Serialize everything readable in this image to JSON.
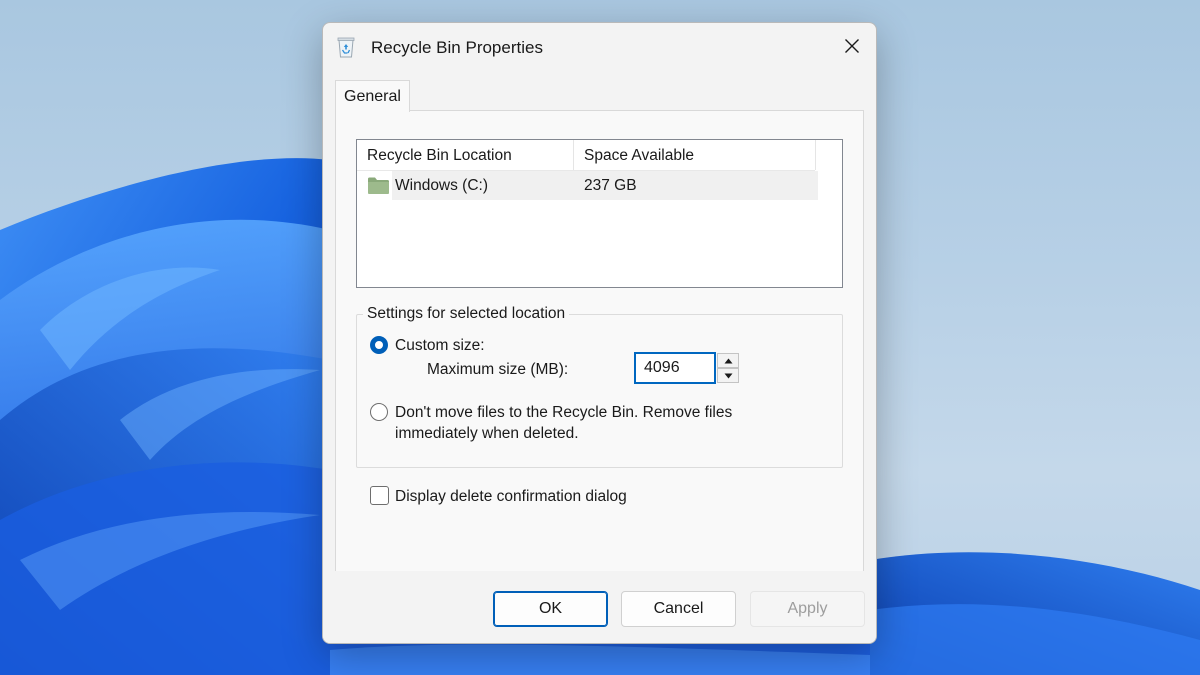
{
  "window": {
    "title": "Recycle Bin Properties",
    "icon": "recycle-bin-icon"
  },
  "tabs": [
    {
      "label": "General",
      "selected": true
    }
  ],
  "location_list": {
    "columns": [
      "Recycle Bin Location",
      "Space Available"
    ],
    "rows": [
      {
        "location": "Windows (C:)",
        "space": "237 GB",
        "icon": "folder-icon"
      }
    ]
  },
  "settings": {
    "group_label": "Settings for selected location",
    "custom_size_label": "Custom size:",
    "custom_size_selected": true,
    "max_size_label": "Maximum size (MB):",
    "max_size_value": "4096",
    "dont_move_label_line1": "Don't move files to the Recycle Bin. Remove files",
    "dont_move_label_line2": "immediately when deleted.",
    "dont_move_selected": false
  },
  "confirm": {
    "label": "Display delete confirmation dialog",
    "checked": false
  },
  "buttons": {
    "ok": "OK",
    "cancel": "Cancel",
    "apply": "Apply"
  },
  "colors": {
    "accent": "#005fb8",
    "focus_border": "#0067c0",
    "folder": "#8aa97a"
  }
}
